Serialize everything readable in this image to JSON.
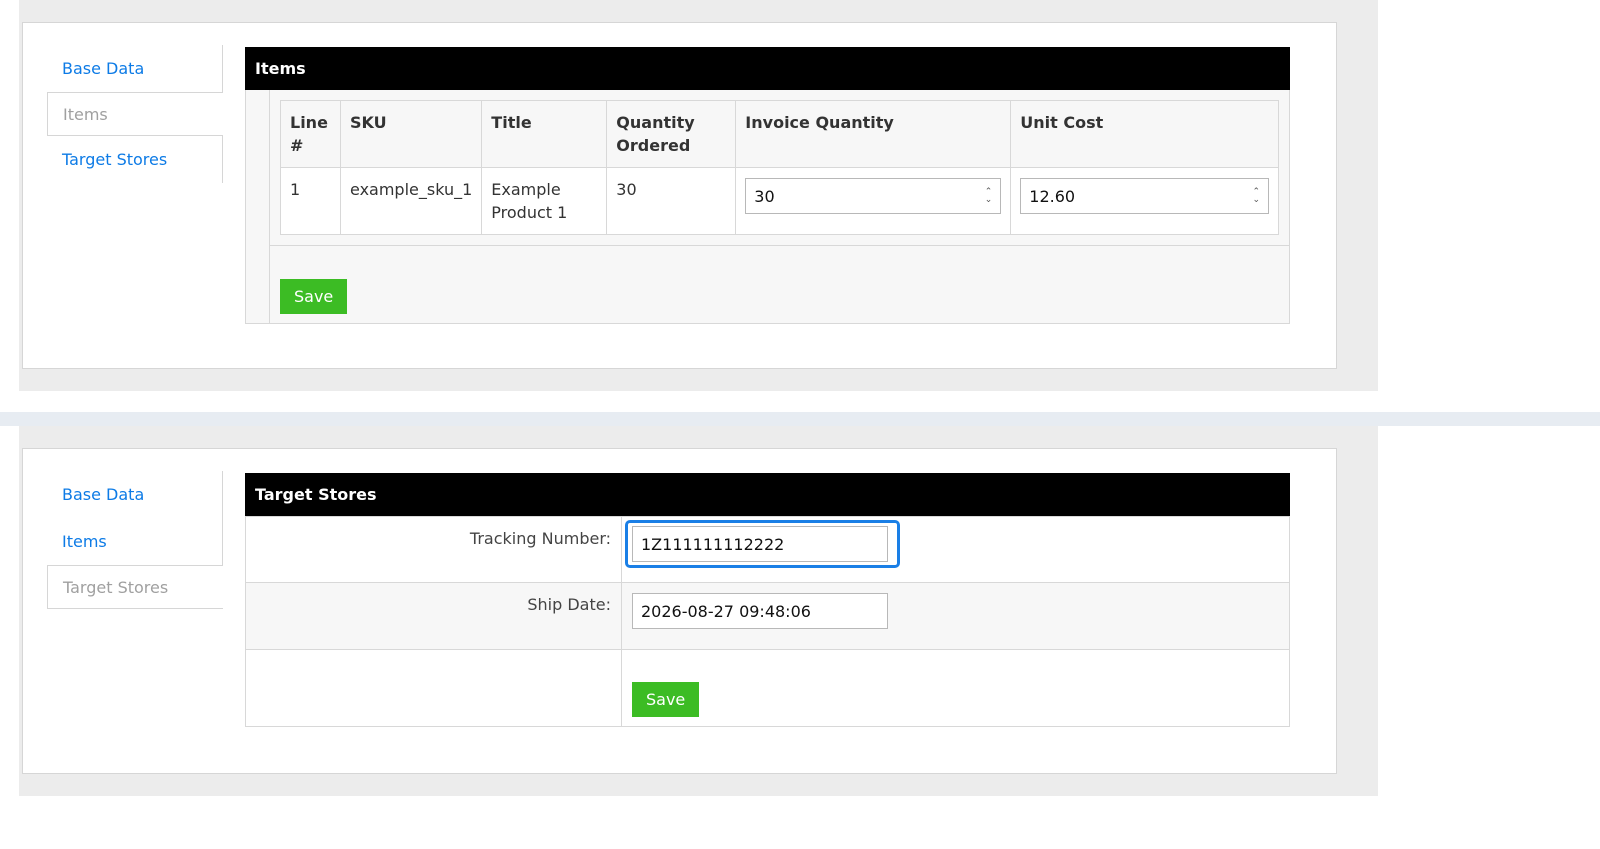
{
  "nav": {
    "base_data": "Base Data",
    "items": "Items",
    "target_stores": "Target Stores"
  },
  "items_section": {
    "title": "Items",
    "columns": [
      "Line #",
      "SKU",
      "Title",
      "Quantity Ordered",
      "Invoice Quantity",
      "Unit Cost"
    ],
    "rows": [
      {
        "line": "1",
        "sku": "example_sku_1",
        "title": "Example Product 1",
        "quantity_ordered": "30",
        "invoice_quantity": "30",
        "unit_cost": "12.60"
      }
    ],
    "save_label": "Save"
  },
  "target_stores_section": {
    "title": "Target Stores",
    "tracking_label": "Tracking Number:",
    "tracking_value": "1Z111111112222",
    "ship_date_label": "Ship Date:",
    "ship_date_value": "2026-08-27 09:48:06",
    "save_label": "Save"
  },
  "colors": {
    "link": "#0d7be6",
    "save_button": "#3cbc24",
    "header_bg": "#000000",
    "focus_ring": "#1a7fe6"
  }
}
